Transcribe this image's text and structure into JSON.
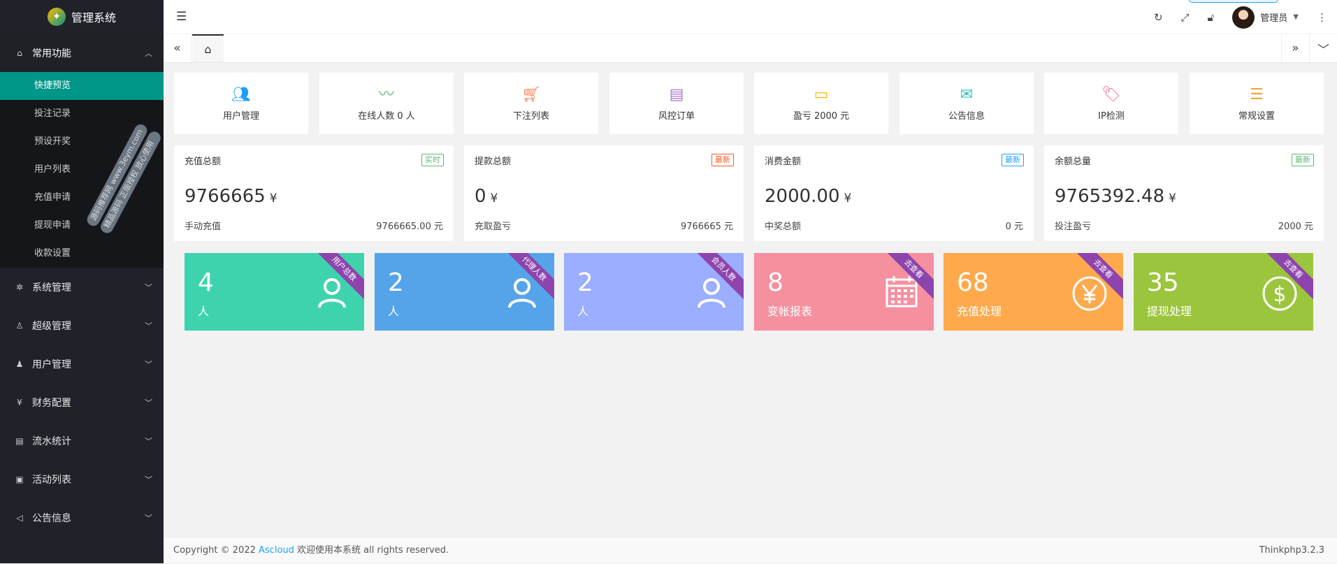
{
  "app": {
    "title": "管理系统"
  },
  "sidebar": {
    "groups": [
      {
        "label": "常用功能",
        "icon": "home-icon"
      },
      {
        "label": "系统管理",
        "icon": "gear-icon"
      },
      {
        "label": "超级管理",
        "icon": "user-icon"
      },
      {
        "label": "用户管理",
        "icon": "users-icon"
      },
      {
        "label": "财务配置",
        "icon": "yen-icon"
      },
      {
        "label": "流水统计",
        "icon": "clipboard-icon"
      },
      {
        "label": "活动列表",
        "icon": "gift-icon"
      },
      {
        "label": "公告信息",
        "icon": "speaker-icon"
      }
    ],
    "subitems": [
      "快捷预览",
      "投注记录",
      "预设开奖",
      "用户列表",
      "充值申请",
      "提现申请",
      "收款设置"
    ]
  },
  "topbar": {
    "user_name": "管理员"
  },
  "shortcuts": [
    {
      "label": "用户管理",
      "icon": "users-icon",
      "color": "#1e9fff"
    },
    {
      "label": "在线人数 0 人",
      "icon": "pulse-icon",
      "color": "#5fb878"
    },
    {
      "label": "下注列表",
      "icon": "cart-icon",
      "color": "#ff7f50"
    },
    {
      "label": "风控订单",
      "icon": "document-icon",
      "color": "#a678d6"
    },
    {
      "label": "盈亏 2000 元",
      "icon": "card-icon",
      "color": "#ffb800"
    },
    {
      "label": "公告信息",
      "icon": "mail-icon",
      "color": "#2ec3c3"
    },
    {
      "label": "IP检测",
      "icon": "tag-icon",
      "color": "#ff6f91"
    },
    {
      "label": "常规设置",
      "icon": "sliders-icon",
      "color": "#f0a640"
    }
  ],
  "stats": [
    {
      "title": "充值总额",
      "badge": "实时",
      "badge_color": "green",
      "value": "9766665",
      "unit": "¥",
      "bottom_left": "手动充值",
      "bottom_right": "9766665.00 元"
    },
    {
      "title": "提款总额",
      "badge": "最新",
      "badge_color": "red",
      "value": "0",
      "unit": "¥",
      "bottom_left": "充取盈亏",
      "bottom_right": "9766665 元"
    },
    {
      "title": "消费金额",
      "badge": "最新",
      "badge_color": "blue",
      "value": "2000.00",
      "unit": "¥",
      "bottom_left": "中奖总额",
      "bottom_right": "0 元"
    },
    {
      "title": "余额总量",
      "badge": "最新",
      "badge_color": "green",
      "value": "9765392.48",
      "unit": "¥",
      "bottom_left": "投注盈亏",
      "bottom_right": "2000 元"
    }
  ],
  "cards": [
    {
      "number": "4",
      "label": "人",
      "ribbon": "用户总数",
      "color": "#3fd3ad",
      "icon": "person-icon"
    },
    {
      "number": "2",
      "label": "人",
      "ribbon": "代理人数",
      "color": "#55a4ea",
      "icon": "person-icon"
    },
    {
      "number": "2",
      "label": "人",
      "ribbon": "会员人数",
      "color": "#9baeff",
      "icon": "person-icon"
    },
    {
      "number": "8",
      "label": "变帐报表",
      "ribbon": "去查看",
      "color": "#f5909f",
      "icon": "calendar-icon"
    },
    {
      "number": "68",
      "label": "充值处理",
      "ribbon": "去查看",
      "color": "#ffa94d",
      "icon": "yen-circle-icon"
    },
    {
      "number": "35",
      "label": "提现处理",
      "ribbon": "去查看",
      "color": "#9bc53d",
      "icon": "dollar-circle-icon"
    }
  ],
  "footer": {
    "copyright": "Copyright © 2022",
    "link": "Ascloud",
    "text": "欢迎使用本系统 all rights reserved.",
    "version": "Thinkphp3.2.3"
  },
  "watermark": {
    "line1": "源码推荐网 www.3eym.com",
    "line2": "精品源码 正版授权 放心使用"
  }
}
